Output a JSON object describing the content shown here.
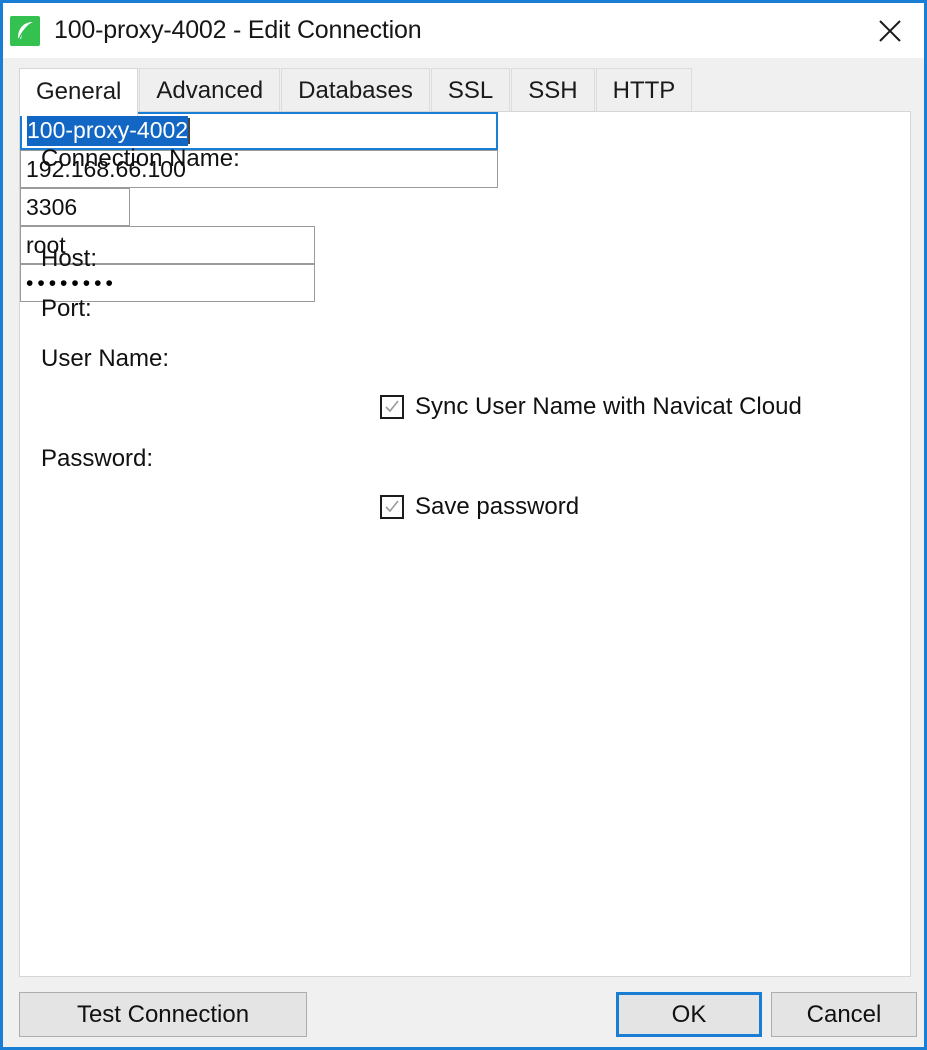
{
  "window": {
    "title": "100-proxy-4002 - Edit Connection",
    "app_icon": "navicat-leaf-icon",
    "close_icon": "close-icon",
    "border_color": "#1a7fd4"
  },
  "tabs": [
    {
      "label": "General",
      "active": true
    },
    {
      "label": "Advanced",
      "active": false
    },
    {
      "label": "Databases",
      "active": false
    },
    {
      "label": "SSL",
      "active": false
    },
    {
      "label": "SSH",
      "active": false
    },
    {
      "label": "HTTP",
      "active": false
    }
  ],
  "form": {
    "connection_name": {
      "label": "Connection Name:",
      "value": "100-proxy-4002",
      "selected": true,
      "focused": true
    },
    "host": {
      "label": "Host:",
      "value": "192.168.66.100"
    },
    "port": {
      "label": "Port:",
      "value": "3306"
    },
    "user_name": {
      "label": "User Name:",
      "value": "root"
    },
    "sync_user_name": {
      "label": "Sync User Name with Navicat Cloud",
      "checked": true
    },
    "password": {
      "label": "Password:",
      "value": "••••••••",
      "masked_char_count": "8"
    },
    "save_password": {
      "label": "Save password",
      "checked": true
    }
  },
  "footer": {
    "test_connection": "Test Connection",
    "ok": "OK",
    "cancel": "Cancel"
  }
}
